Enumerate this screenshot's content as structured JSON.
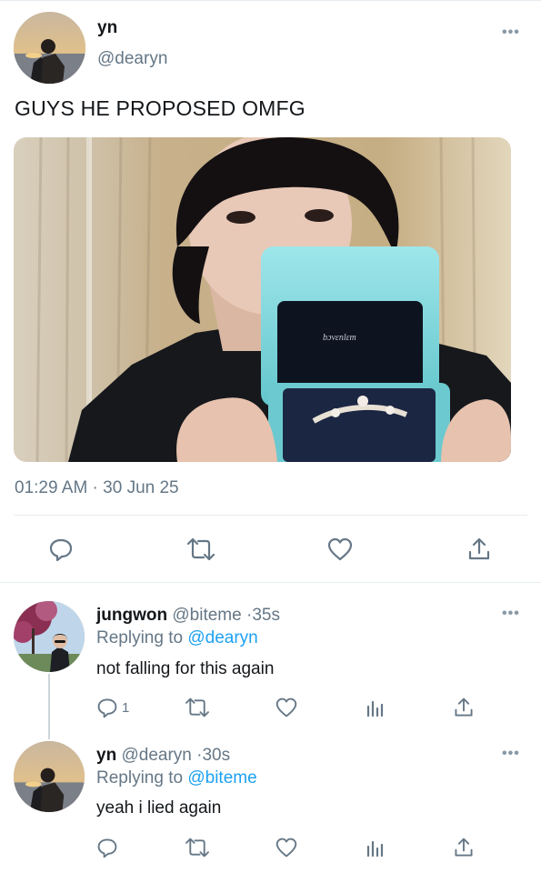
{
  "tweet": {
    "display_name": "yn",
    "handle": "@dearyn",
    "text": "GUYS HE PROPOSED OMFG",
    "timestamp": "01:29 AM · 30 Jun 25",
    "more_icon": "more-icon",
    "actions": [
      "reply-icon",
      "retweet-icon",
      "like-icon",
      "share-icon"
    ]
  },
  "replies": [
    {
      "name": "jungwon",
      "handle": "@biteme",
      "sep": "·",
      "time": "35s",
      "replying_prefix": "Replying to",
      "replying_to": "@dearyn",
      "text": "not falling for this again",
      "reply_count": "1",
      "actions": [
        "reply-icon",
        "retweet-icon",
        "like-icon",
        "analytics-icon",
        "share-icon"
      ]
    },
    {
      "name": "yn",
      "handle": "@dearyn",
      "sep": "·",
      "time": "30s",
      "replying_prefix": "Replying to",
      "replying_to": "@biteme",
      "text": "yeah i lied again",
      "reply_count": "",
      "actions": [
        "reply-icon",
        "retweet-icon",
        "like-icon",
        "analytics-icon",
        "share-icon"
      ]
    }
  ],
  "colors": {
    "link": "#1da1f2",
    "secondary_text": "#657786",
    "icon": "#657786",
    "divider": "#e6ecf0"
  }
}
